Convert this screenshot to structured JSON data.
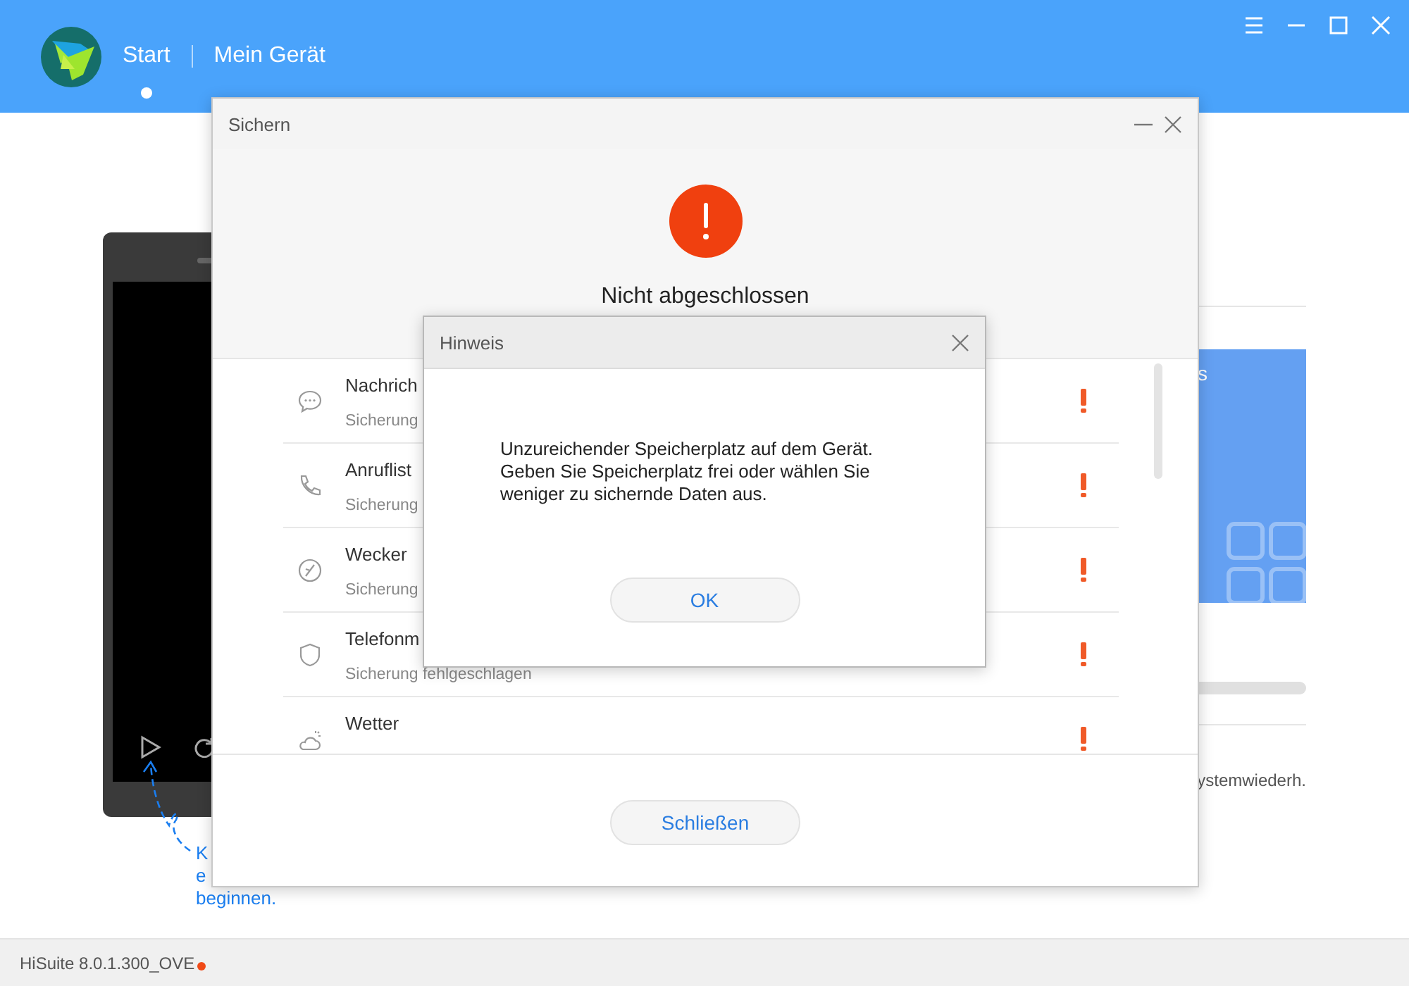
{
  "header": {
    "tabs": [
      {
        "label": "Start",
        "selected": true
      },
      {
        "label": "Mein Gerät",
        "selected": false
      }
    ]
  },
  "background": {
    "card_text": "s",
    "restore_text": "ystemwiederh.",
    "hint_lines": [
      "K",
      "e",
      "beginnen."
    ]
  },
  "backup_dialog": {
    "title": "Sichern",
    "status": "Nicht abgeschlossen",
    "items": [
      {
        "kind": "messages",
        "name": "Nachrich",
        "status": "Sicherung",
        "failed": true
      },
      {
        "kind": "calls",
        "name": "Anruflist",
        "status": "Sicherung",
        "failed": true
      },
      {
        "kind": "alarm",
        "name": "Wecker",
        "status": "Sicherung",
        "failed": true
      },
      {
        "kind": "shield",
        "name": "Telefonm",
        "status": "Sicherung fehlgeschlagen",
        "failed": true
      },
      {
        "kind": "weather",
        "name": "Wetter",
        "failed": true
      }
    ],
    "close_button": "Schließen"
  },
  "notice_dialog": {
    "title": "Hinweis",
    "message": "Unzureichender Speicherplatz auf dem Gerät.\nGeben Sie Speicherplatz frei oder wählen Sie\nweniger zu sichernde Daten aus.",
    "button": "OK"
  },
  "status_bar": {
    "version": "HiSuite 8.0.1.300_OVE"
  }
}
